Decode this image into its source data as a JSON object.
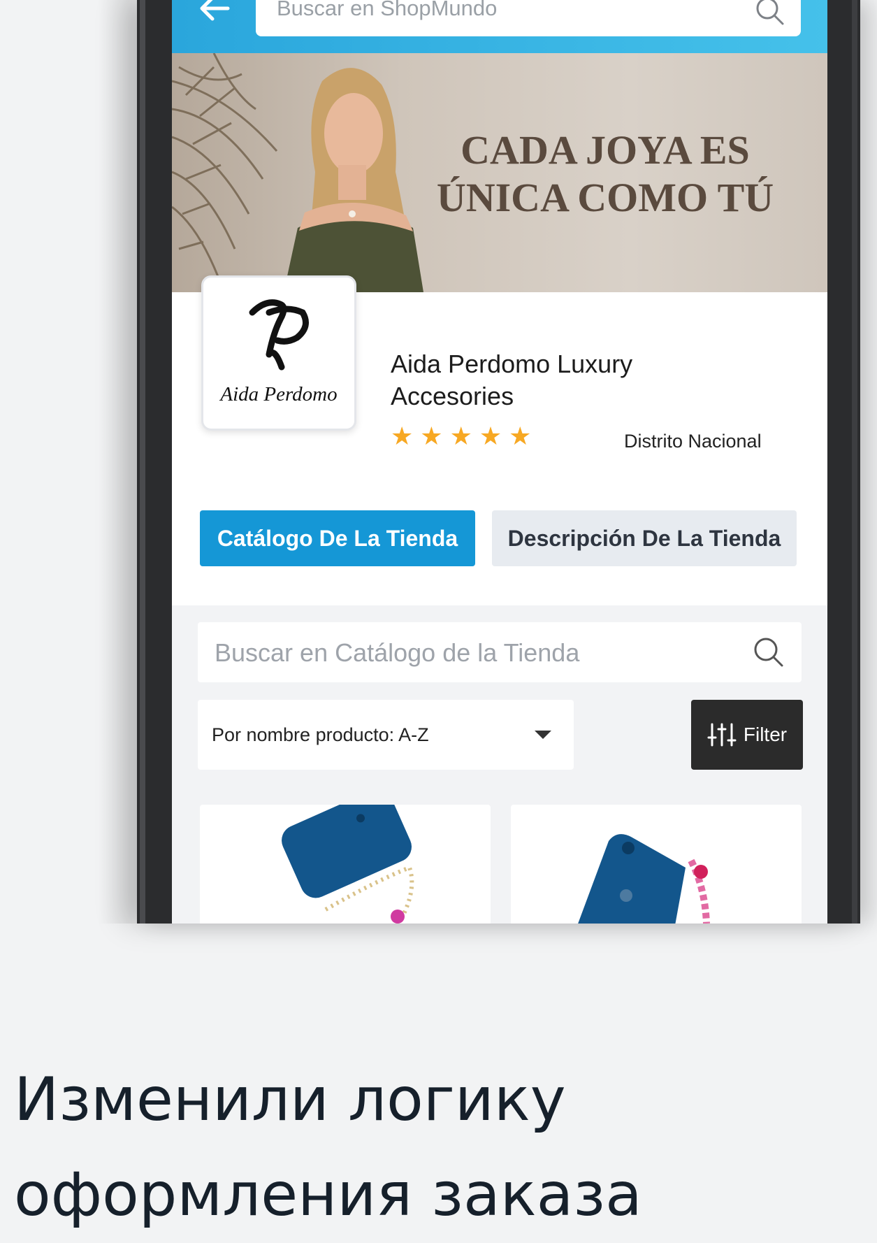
{
  "app": {
    "top_search_placeholder": "Buscar en ShopMundo"
  },
  "banner": {
    "tagline_line1": "CADA JOYA ES",
    "tagline_line2": "ÚNICA COMO TÚ"
  },
  "store": {
    "logo_text": "Aida Perdomo",
    "name": "Aida Perdomo Luxury Accesories",
    "rating": 5,
    "rating_max": 5,
    "location": "Distrito Nacional"
  },
  "tabs": [
    {
      "label": "Catálogo De La Tienda",
      "active": true
    },
    {
      "label": "Descripción De La Tienda",
      "active": false
    }
  ],
  "catalog": {
    "search_placeholder": "Buscar en Catálogo de la Tienda",
    "sort_value": "Por nombre producto: A-Z",
    "filter_label": "Filter"
  },
  "colors": {
    "accent": "#1597d6",
    "topbar": "#2aa6dc",
    "star": "#f7a823"
  },
  "headline": {
    "line1": "Изменили логику",
    "line2": "оформления заказа"
  }
}
